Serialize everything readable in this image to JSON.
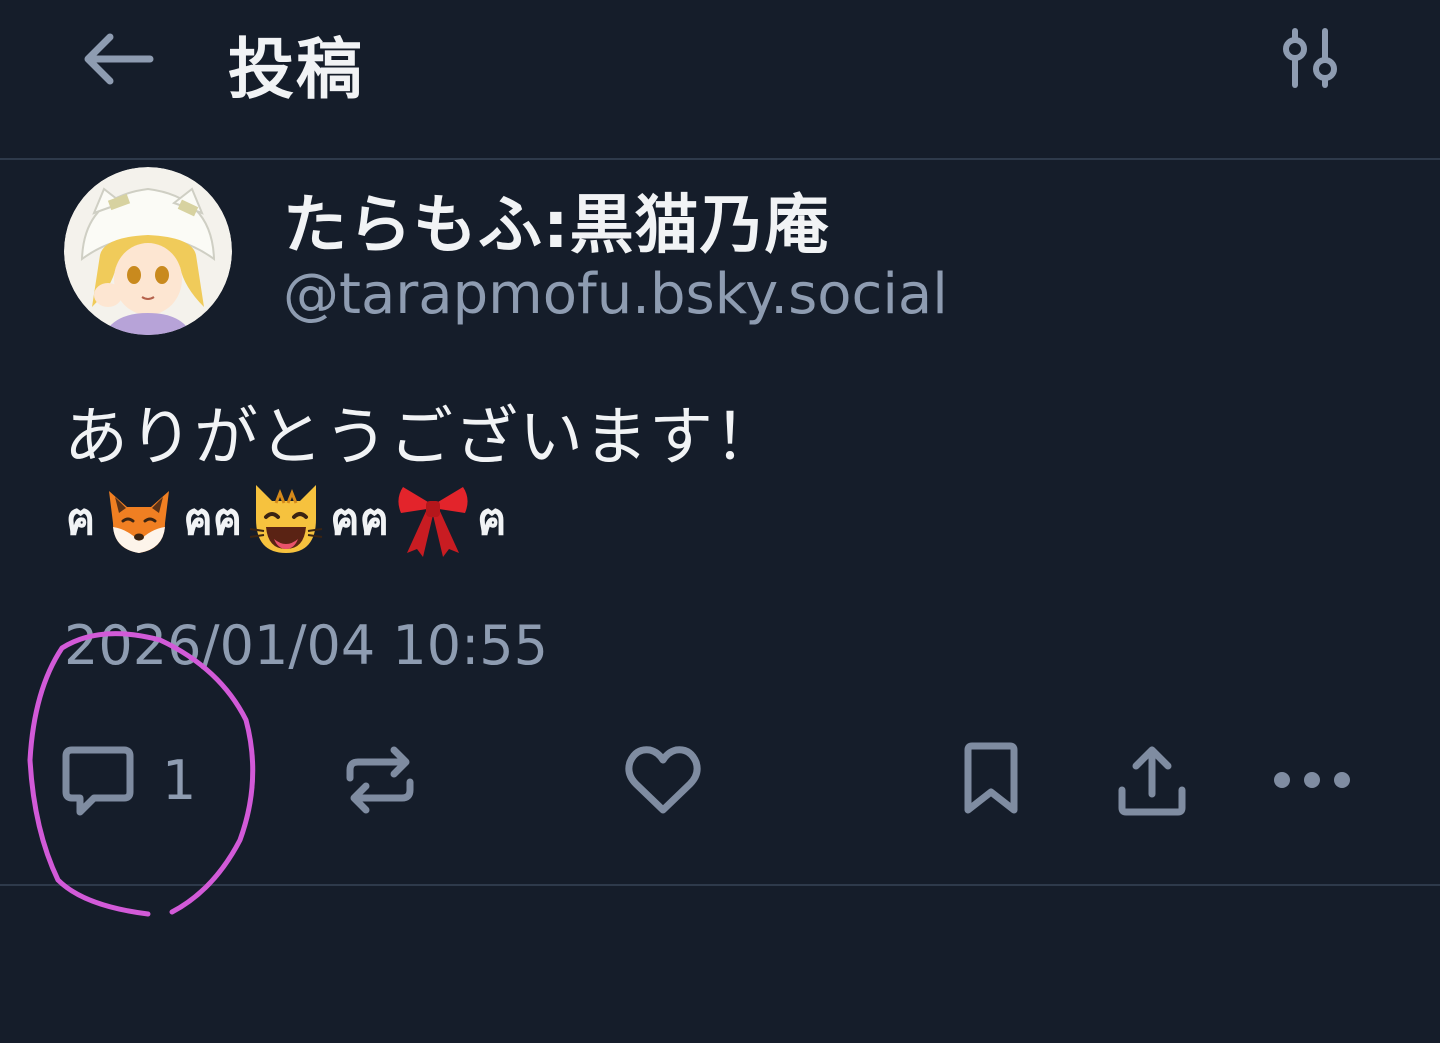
{
  "header": {
    "title": "投稿",
    "back_icon": "arrow-left-icon",
    "filter_icon": "sliders-icon"
  },
  "author": {
    "display_name": "たらもふ:黒猫乃庵",
    "handle": "@tarapmofu.bsky.social"
  },
  "post": {
    "text": "ありがとうございます！",
    "emoji_line": [
      "ฅ",
      "fox-emoji",
      "ฅฅ",
      "grinning-cat-emoji",
      "ฅฅ",
      "ribbon-emoji",
      "ฅ"
    ],
    "glyph_1": "ฅ",
    "glyph_2": "ฅฅ",
    "glyph_3": "ฅฅ",
    "glyph_4": "ฅ",
    "timestamp": "2026/01/04 10:55"
  },
  "actions": {
    "reply_count": "1",
    "reply_icon": "comment-icon",
    "repost_icon": "repost-icon",
    "like_icon": "heart-icon",
    "bookmark_icon": "bookmark-icon",
    "share_icon": "share-icon",
    "more_icon": "more-horizontal-icon"
  },
  "colors": {
    "background": "#151d2a",
    "text_primary": "#f1f3f5",
    "text_secondary": "#8e9cb1",
    "icon": "#7f8ca1",
    "divider": "#2e3a4b",
    "annotation": "#d25ad8"
  }
}
